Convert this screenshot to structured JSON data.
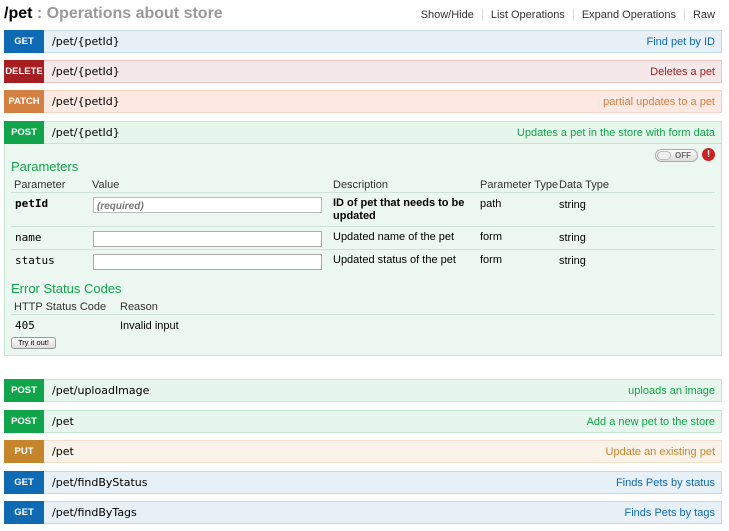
{
  "header": {
    "resource": "/pet",
    "separator": " : ",
    "description": "Operations about store",
    "links": [
      "Show/Hide",
      "List Operations",
      "Expand Operations",
      "Raw"
    ]
  },
  "operations": [
    {
      "method": "GET",
      "path": "/pet/{petId}",
      "summary": "Find pet by ID"
    },
    {
      "method": "DELETE",
      "path": "/pet/{petId}",
      "summary": "Deletes a pet"
    },
    {
      "method": "PATCH",
      "path": "/pet/{petId}",
      "summary": "partial updates to a pet"
    },
    {
      "method": "POST",
      "path": "/pet/{petId}",
      "summary": "Updates a pet in the store with form data"
    },
    {
      "method": "POST",
      "path": "/pet/uploadImage",
      "summary": "uploads an image"
    },
    {
      "method": "POST",
      "path": "/pet",
      "summary": "Add a new pet to the store"
    },
    {
      "method": "PUT",
      "path": "/pet",
      "summary": "Update an existing pet"
    },
    {
      "method": "GET",
      "path": "/pet/findByStatus",
      "summary": "Finds Pets by status"
    },
    {
      "method": "GET",
      "path": "/pet/findByTags",
      "summary": "Finds Pets by tags"
    }
  ],
  "expanded": {
    "toggle_label": "OFF",
    "warning_glyph": "!",
    "parameters_title": "Parameters",
    "param_headers": [
      "Parameter",
      "Value",
      "Description",
      "Parameter Type",
      "Data Type"
    ],
    "params": [
      {
        "name": "petId",
        "value": "",
        "placeholder": "(required)",
        "description": "ID of pet that needs to be updated",
        "param_type": "path",
        "data_type": "string"
      },
      {
        "name": "name",
        "value": "",
        "placeholder": "",
        "description": "Updated name of the pet",
        "param_type": "form",
        "data_type": "string"
      },
      {
        "name": "status",
        "value": "",
        "placeholder": "",
        "description": "Updated status of the pet",
        "param_type": "form",
        "data_type": "string"
      }
    ],
    "error_title": "Error Status Codes",
    "error_headers": [
      "HTTP Status Code",
      "Reason"
    ],
    "errors": [
      {
        "code": "405",
        "reason": "Invalid input"
      }
    ],
    "try_button": "Try it out!"
  },
  "colors": {
    "GET": "#0f6ab4",
    "DELETE": "#a41e22",
    "PATCH": "#d38042",
    "POST": "#10a54a",
    "PUT": "#c5862b"
  }
}
